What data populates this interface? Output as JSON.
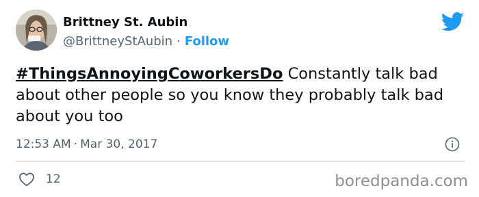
{
  "tweet": {
    "author": {
      "name": "Brittney St. Aubin",
      "handle": "@BrittneyStAubin",
      "separator": "·",
      "follow_label": "Follow"
    },
    "text": {
      "hashtag": "#ThingsAnnoyingCoworkersDo",
      "body": " Constantly talk bad about other people so you know they probably talk bad about you too"
    },
    "timestamp": {
      "time": "12:53 AM",
      "separator": "·",
      "date": "Mar 30, 2017"
    },
    "likes": {
      "count": "12"
    },
    "colors": {
      "twitter_blue": "#1d9bf0",
      "text_primary": "#0f1419",
      "text_secondary": "#536471",
      "divider": "#cfd9de"
    },
    "icons": {
      "logo": "twitter-bird-icon",
      "info": "info-icon",
      "like": "heart-icon"
    }
  },
  "watermark": "boredpanda.com"
}
